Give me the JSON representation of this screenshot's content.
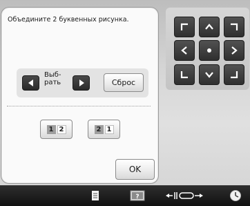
{
  "dialog": {
    "title": "Объедините 2 буквенных рисунка.",
    "select_label": "Выб-\nрать",
    "reset_label": "Сброс",
    "ok_label": "OK",
    "order_options": [
      {
        "first": "1",
        "second": "2"
      },
      {
        "first": "2",
        "second": "1"
      }
    ]
  },
  "keypad": {
    "keys": [
      "up-left-arrow-icon",
      "up-arrow-icon",
      "up-right-arrow-icon",
      "left-arrow-icon",
      "center-dot-icon",
      "right-arrow-icon",
      "down-left-arrow-icon",
      "down-arrow-icon",
      "down-right-arrow-icon"
    ]
  },
  "bottombar": {
    "icons": [
      "page-icon",
      "help-icon",
      "frame-move-icon",
      "clock-icon"
    ]
  },
  "colors": {
    "key_dark": "#3a3a3a",
    "dialog_bg": "#fafafa",
    "bar_bg": "#1c1c1c"
  }
}
